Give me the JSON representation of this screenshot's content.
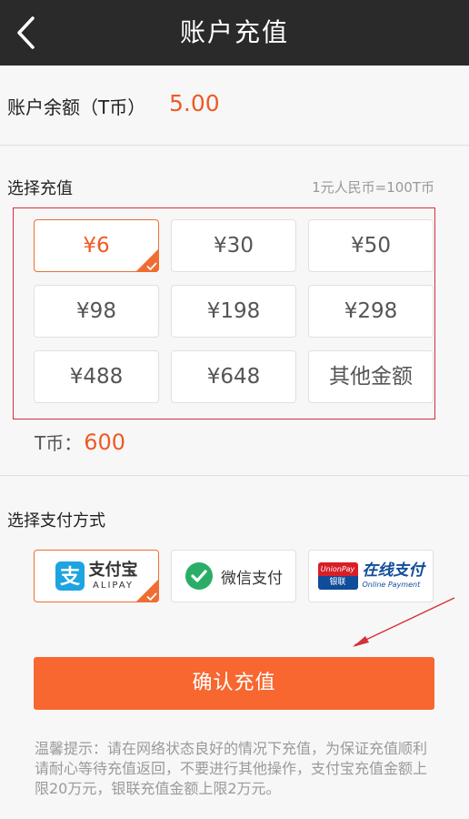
{
  "header": {
    "title": "账户充值"
  },
  "balance": {
    "label": "账户余额（T币）",
    "value": "5.00"
  },
  "recharge": {
    "section_label": "选择充值",
    "rate_note": "1元人民币=100T币",
    "amounts": [
      {
        "label": "¥6",
        "selected": true
      },
      {
        "label": "¥30",
        "selected": false
      },
      {
        "label": "¥50",
        "selected": false
      },
      {
        "label": "¥98",
        "selected": false
      },
      {
        "label": "¥198",
        "selected": false
      },
      {
        "label": "¥298",
        "selected": false
      },
      {
        "label": "¥488",
        "selected": false
      },
      {
        "label": "¥648",
        "selected": false
      },
      {
        "label": "其他金额",
        "selected": false
      }
    ],
    "tcoin_label": "T币：",
    "tcoin_value": "600"
  },
  "payment": {
    "section_label": "选择支付方式",
    "methods": [
      {
        "name": "支付宝",
        "sub": "ALIPAY",
        "icon": "alipay-icon",
        "selected": true
      },
      {
        "name": "微信支付",
        "icon": "wechat-pay-icon",
        "selected": false
      },
      {
        "name": "在线支付",
        "sub": "Online Payment",
        "badge_top": "UnionPay",
        "badge_bottom": "银联",
        "icon": "unionpay-icon",
        "selected": false
      }
    ]
  },
  "confirm": {
    "label": "确认充值"
  },
  "tip": {
    "text": "温馨提示：请在网络状态良好的情况下充值，为保证充值顺利请耐心等待充值返回，不要进行其他操作，支付宝充值金额上限20万元，银联充值金额上限2万元。"
  },
  "colors": {
    "accent": "#f86730",
    "header_bg": "#2a2a2a",
    "highlight_frame": "#d6303a",
    "alipay": "#1ea4e0",
    "wechat": "#2aae67",
    "unionpay_red": "#d71f26",
    "unionpay_blue": "#0f4c9a"
  }
}
